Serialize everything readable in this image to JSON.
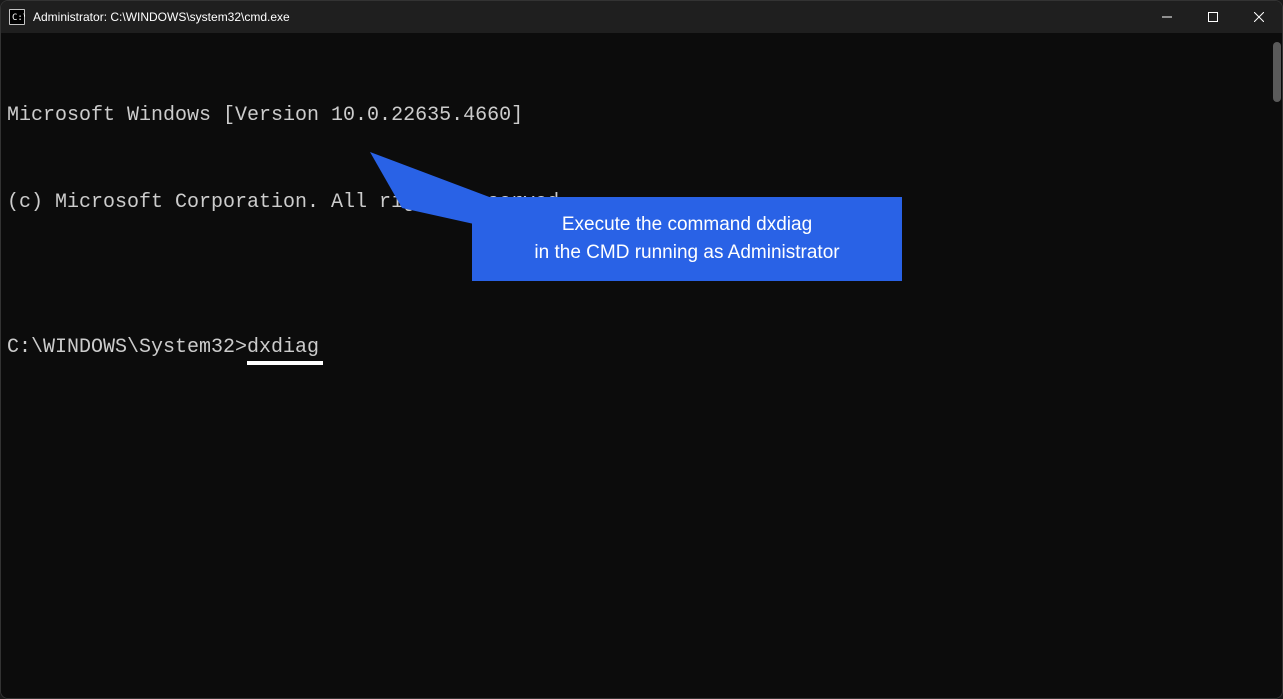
{
  "window": {
    "title": "Administrator: C:\\WINDOWS\\system32\\cmd.exe"
  },
  "terminal": {
    "line1": "Microsoft Windows [Version 10.0.22635.4660]",
    "line2": "(c) Microsoft Corporation. All rights reserved.",
    "blank": "",
    "prompt": "C:\\WINDOWS\\System32>",
    "command": "dxdiag"
  },
  "callout": {
    "line1": "Execute the command dxdiag",
    "line2": "in the CMD running as Administrator"
  }
}
